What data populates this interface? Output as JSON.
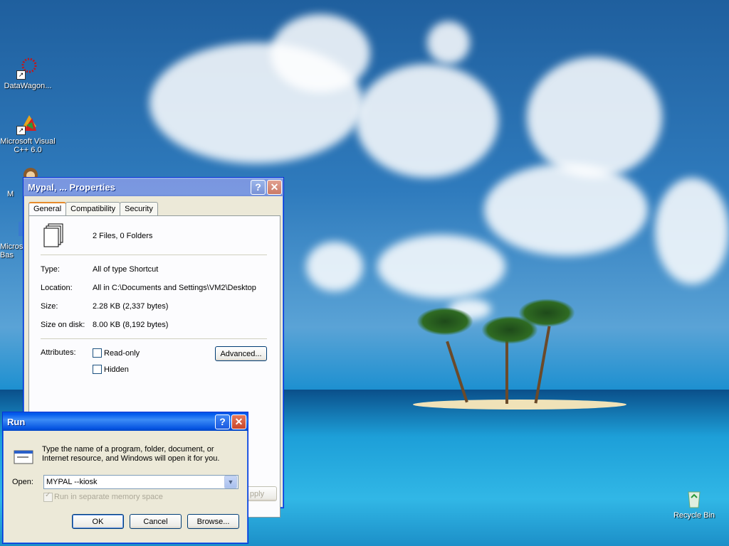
{
  "desktop": {
    "icons": [
      {
        "label": "DataWagon..."
      },
      {
        "label": "Microsoft Visual C++ 6.0"
      },
      {
        "label": "M"
      },
      {
        "label": "Micros Bas"
      },
      {
        "label": "Recycle Bin"
      }
    ]
  },
  "properties": {
    "title": "Mypal, ... Properties",
    "tabs": [
      "General",
      "Compatibility",
      "Security"
    ],
    "summary": "2 Files, 0 Folders",
    "rows": [
      {
        "label": "Type:",
        "value": "All of type Shortcut"
      },
      {
        "label": "Location:",
        "value": "All in C:\\Documents and Settings\\VM2\\Desktop"
      },
      {
        "label": "Size:",
        "value": "2.28 KB (2,337 bytes)"
      },
      {
        "label": "Size on disk:",
        "value": "8.00 KB (8,192 bytes)"
      }
    ],
    "attributes_label": "Attributes:",
    "readonly_label": "Read-only",
    "hidden_label": "Hidden",
    "advanced_label": "Advanced...",
    "apply_label": "pply"
  },
  "run": {
    "title": "Run",
    "description": "Type the name of a program, folder, document, or Internet resource, and Windows will open it for you.",
    "open_label": "Open:",
    "open_value": "MYPAL --kiosk",
    "separate_memory_label": "Run in separate memory space",
    "ok_label": "OK",
    "cancel_label": "Cancel",
    "browse_label": "Browse..."
  },
  "colors": {
    "title_active": "#0553e1",
    "title_inactive": "#7b99e1",
    "dialog_face": "#ece9d8"
  }
}
